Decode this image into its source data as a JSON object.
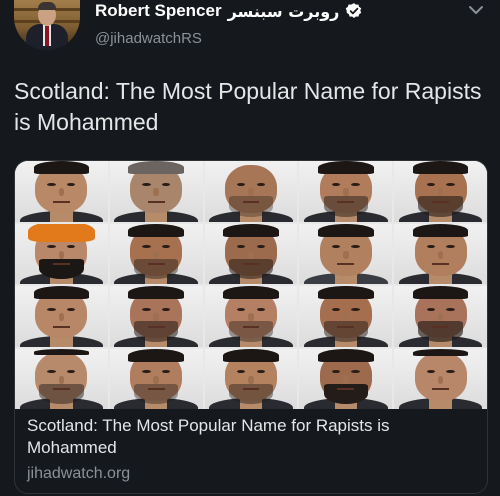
{
  "author": {
    "display_name": "Robert Spencer",
    "display_name_arabic": "روبرت سبنسر",
    "handle": "@jihadwatchRS",
    "verified": true,
    "avatar_icon": "profile-photo"
  },
  "icons": {
    "verified": "verified-badge-icon",
    "more": "chevron-down-icon"
  },
  "tweet": {
    "text": "Scotland: The Most Popular Name for Rapists is Mohammed"
  },
  "link_card": {
    "image_description_icon": "mugshot-grid",
    "title": "Scotland: The Most Popular Name for Rapists is Mohammed",
    "domain": "jihadwatch.org"
  },
  "colors": {
    "background": "#15181c",
    "text_primary": "#e4e6e8",
    "text_secondary": "#8a9199",
    "card_border": "#2f3336",
    "turban": "#e27a1c"
  }
}
